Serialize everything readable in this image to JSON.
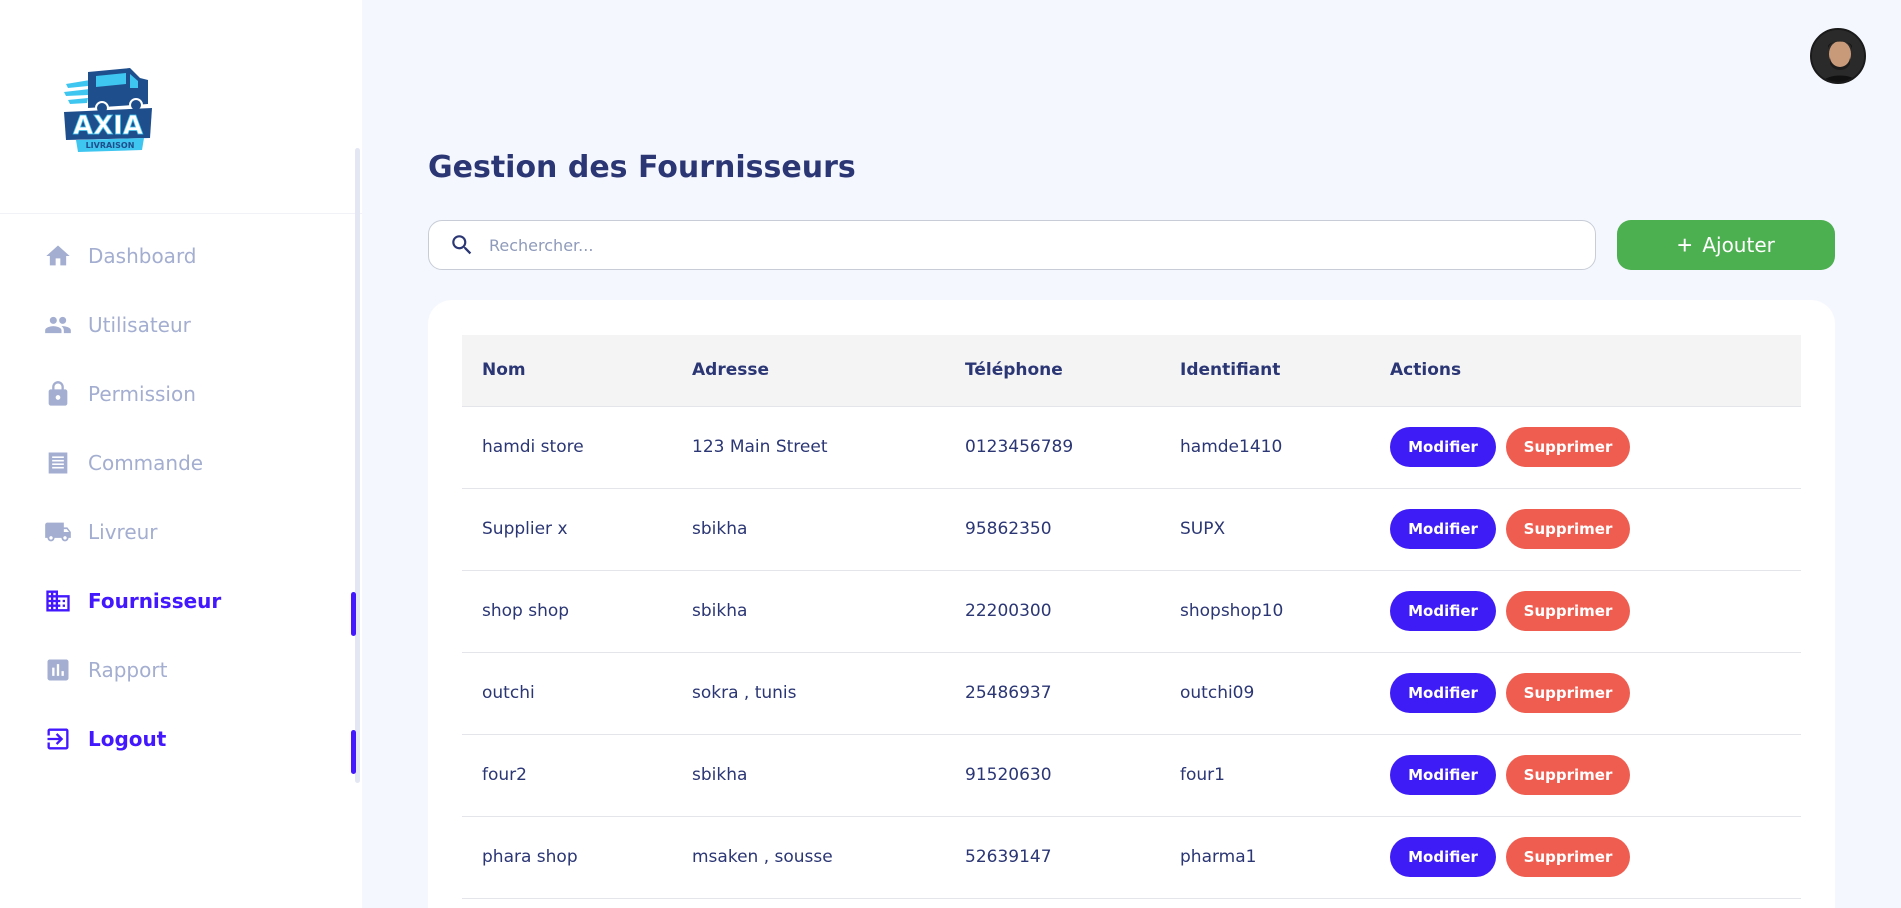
{
  "brand": {
    "logo_text": "AXIA",
    "logo_subtext": "LIVRAISON",
    "logo_colors": {
      "primary": "#1f4e8c",
      "accent": "#3ec5f0"
    }
  },
  "sidebar": {
    "items": [
      {
        "label": "Dashboard",
        "icon": "home-icon",
        "active": false
      },
      {
        "label": "Utilisateur",
        "icon": "users-icon",
        "active": false
      },
      {
        "label": "Permission",
        "icon": "lock-icon",
        "active": false
      },
      {
        "label": "Commande",
        "icon": "receipt-icon",
        "active": false
      },
      {
        "label": "Livreur",
        "icon": "truck-icon",
        "active": false
      },
      {
        "label": "Fournisseur",
        "icon": "building-icon",
        "active": true
      },
      {
        "label": "Rapport",
        "icon": "bar-chart-icon",
        "active": false
      },
      {
        "label": "Logout",
        "icon": "logout-icon",
        "active": true
      }
    ]
  },
  "header": {
    "avatar": "user-avatar"
  },
  "main": {
    "title": "Gestion des Fournisseurs",
    "search": {
      "placeholder": "Rechercher...",
      "value": ""
    },
    "add_button": {
      "label": "Ajouter",
      "icon": "plus-icon"
    }
  },
  "table": {
    "columns": [
      "Nom",
      "Adresse",
      "Téléphone",
      "Identifiant",
      "Actions"
    ],
    "rows": [
      {
        "nom": "hamdi store",
        "adresse": "123 Main Street",
        "telephone": "0123456789",
        "identifiant": "hamde1410"
      },
      {
        "nom": "Supplier x",
        "adresse": "sbikha",
        "telephone": "95862350",
        "identifiant": "SUPX"
      },
      {
        "nom": "shop shop",
        "adresse": "sbikha",
        "telephone": "22200300",
        "identifiant": "shopshop10"
      },
      {
        "nom": "outchi",
        "adresse": "sokra , tunis",
        "telephone": "25486937",
        "identifiant": "outchi09"
      },
      {
        "nom": "four2",
        "adresse": "sbikha",
        "telephone": "91520630",
        "identifiant": "four1"
      },
      {
        "nom": "phara shop",
        "adresse": "msaken , sousse",
        "telephone": "52639147",
        "identifiant": "pharma1"
      }
    ],
    "actions": {
      "edit_label": "Modifier",
      "delete_label": "Supprimer"
    }
  },
  "colors": {
    "accent": "#4318ff",
    "edit": "#3d1cf5",
    "delete": "#ee5d50",
    "add": "#4caf50",
    "text": "#2b3674",
    "muted": "#a3aed0",
    "background": "#f4f7fe"
  }
}
